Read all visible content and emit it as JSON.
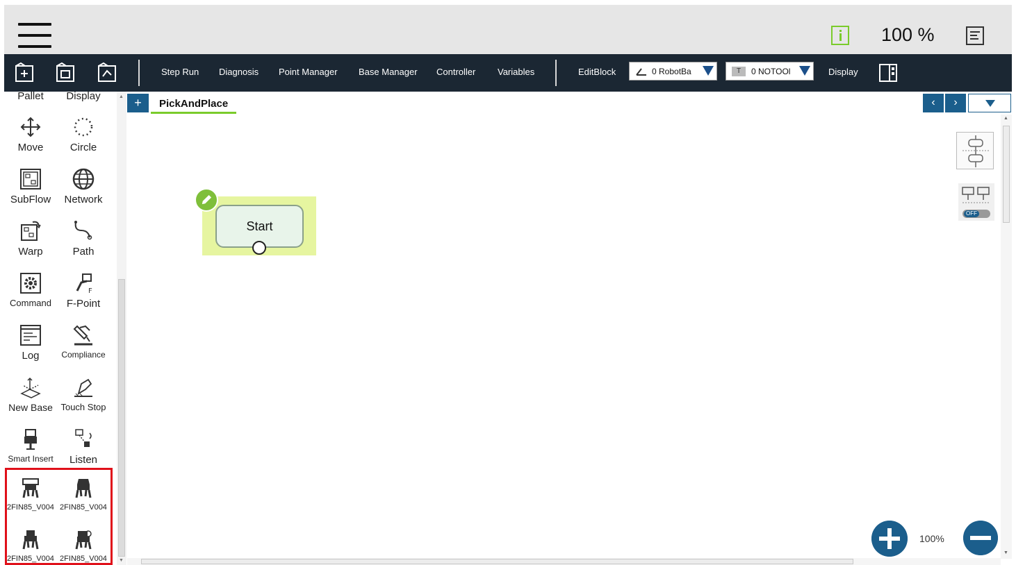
{
  "header": {
    "zoom_text": "100 %"
  },
  "toolbar": {
    "items": [
      "Step Run",
      "Diagnosis",
      "Point Manager",
      "Base Manager",
      "Controller",
      "Variables"
    ],
    "editblock": "EditBlock",
    "base_select": "0 RobotBa",
    "tool_select": "0 NOTOOl",
    "tool_badge": "T",
    "display": "Display"
  },
  "palette": {
    "top_cut": [
      "Pallet",
      "Display"
    ],
    "items": [
      {
        "label": "Move",
        "icon": "move-arrows-icon"
      },
      {
        "label": "Circle",
        "icon": "dotted-circle-icon"
      },
      {
        "label": "SubFlow",
        "icon": "subflow-icon"
      },
      {
        "label": "Network",
        "icon": "globe-icon"
      },
      {
        "label": "Warp",
        "icon": "warp-icon"
      },
      {
        "label": "Path",
        "icon": "path-curve-icon"
      },
      {
        "label": "Command",
        "icon": "gear-box-icon"
      },
      {
        "label": "F-Point",
        "icon": "f-point-icon"
      },
      {
        "label": "Log",
        "icon": "log-window-icon"
      },
      {
        "label": "Compliance",
        "icon": "compliance-icon"
      },
      {
        "label": "New Base",
        "icon": "new-base-icon"
      },
      {
        "label": "Touch Stop",
        "icon": "touch-stop-icon"
      },
      {
        "label": "Smart Insert",
        "icon": "smart-insert-icon"
      },
      {
        "label": "Listen",
        "icon": "listen-icon"
      }
    ],
    "grippers": [
      "2FIN85_V004",
      "2FIN85_V004",
      "2FIN85_V004",
      "2FIN85_V004"
    ]
  },
  "canvas": {
    "tab_add": "+",
    "tab_name": "PickAndPlace",
    "start_node": "Start",
    "zoom_level": "100%",
    "toggle_label": "OFF"
  },
  "colors": {
    "toolbar_bg": "#1b2733",
    "accent_blue": "#1b5e8c",
    "highlight_red": "#e0101a",
    "start_bg": "#e6f5a0",
    "edit_green": "#7fbf3a"
  }
}
